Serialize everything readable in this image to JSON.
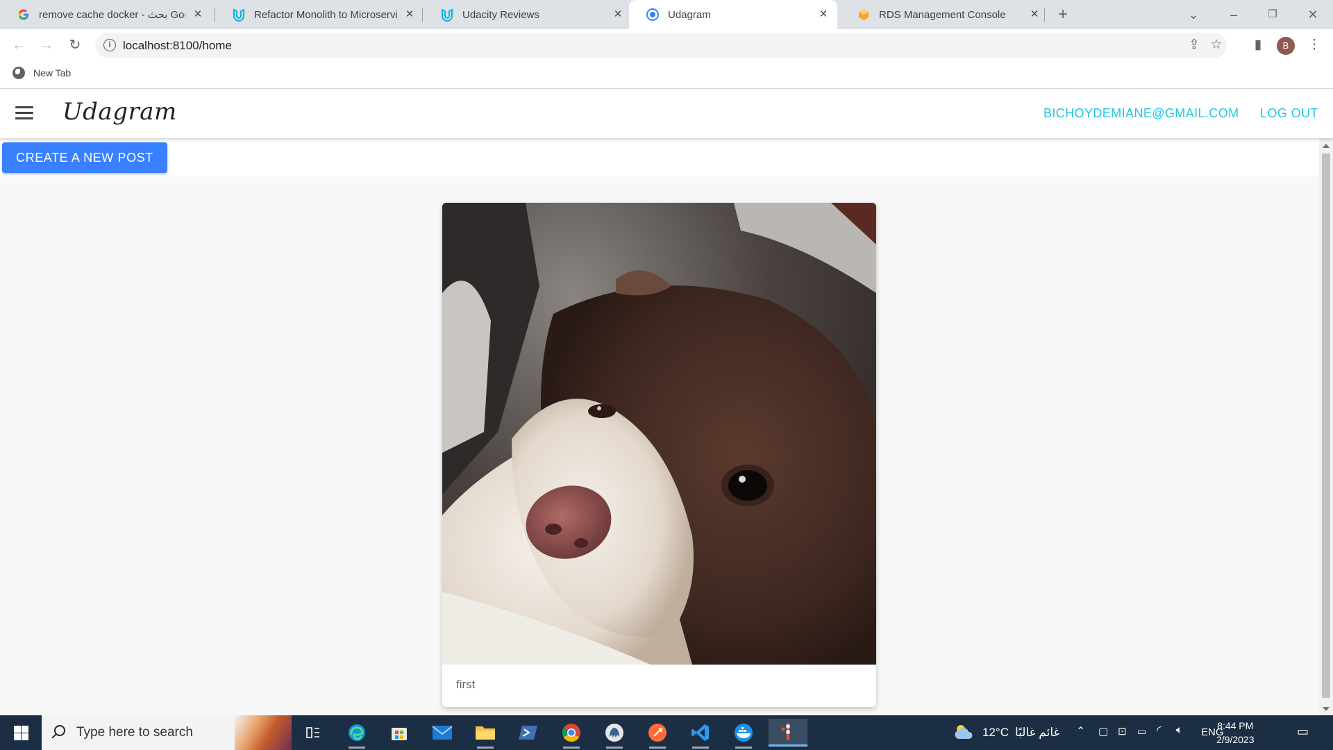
{
  "browser": {
    "tabs": [
      {
        "title": "remove cache docker - بحث Goo",
        "icon": "google-icon",
        "active": false
      },
      {
        "title": "Refactor Monolith to Microservic",
        "icon": "udacity-icon",
        "active": false
      },
      {
        "title": "Udacity Reviews",
        "icon": "udacity-icon",
        "active": false
      },
      {
        "title": "Udagram",
        "icon": "ionic-icon",
        "active": true
      },
      {
        "title": "RDS Management Console",
        "icon": "aws-icon",
        "active": false
      }
    ],
    "url": "localhost:8100/home",
    "profile_initial": "B",
    "bookmarks": [
      {
        "label": "New Tab",
        "icon": "globe-icon"
      }
    ]
  },
  "app": {
    "brand": "Udagram",
    "user_email": "BICHOYDEMIANE@GMAIL.COM",
    "logout_label": "LOG OUT",
    "create_post_label": "CREATE A NEW POST",
    "accent_color": "#3880ff",
    "link_color": "#1ec8e4",
    "feed": [
      {
        "caption": "first",
        "image": "brown and white shaggy dog resting head"
      }
    ]
  },
  "taskbar": {
    "search_placeholder": "Type here to search",
    "apps": [
      "task-view-icon",
      "edge-icon",
      "store-icon",
      "mail-icon",
      "file-explorer-icon",
      "powershell-icon",
      "chrome-icon",
      "pgadmin-icon",
      "postman-icon",
      "vscode-icon",
      "docker-icon",
      "git-icon"
    ],
    "weather": {
      "temp": "12°C",
      "condition": "غائم غالبًا"
    },
    "language": "ENG",
    "time": "8:44 PM",
    "date": "2/9/2023"
  }
}
